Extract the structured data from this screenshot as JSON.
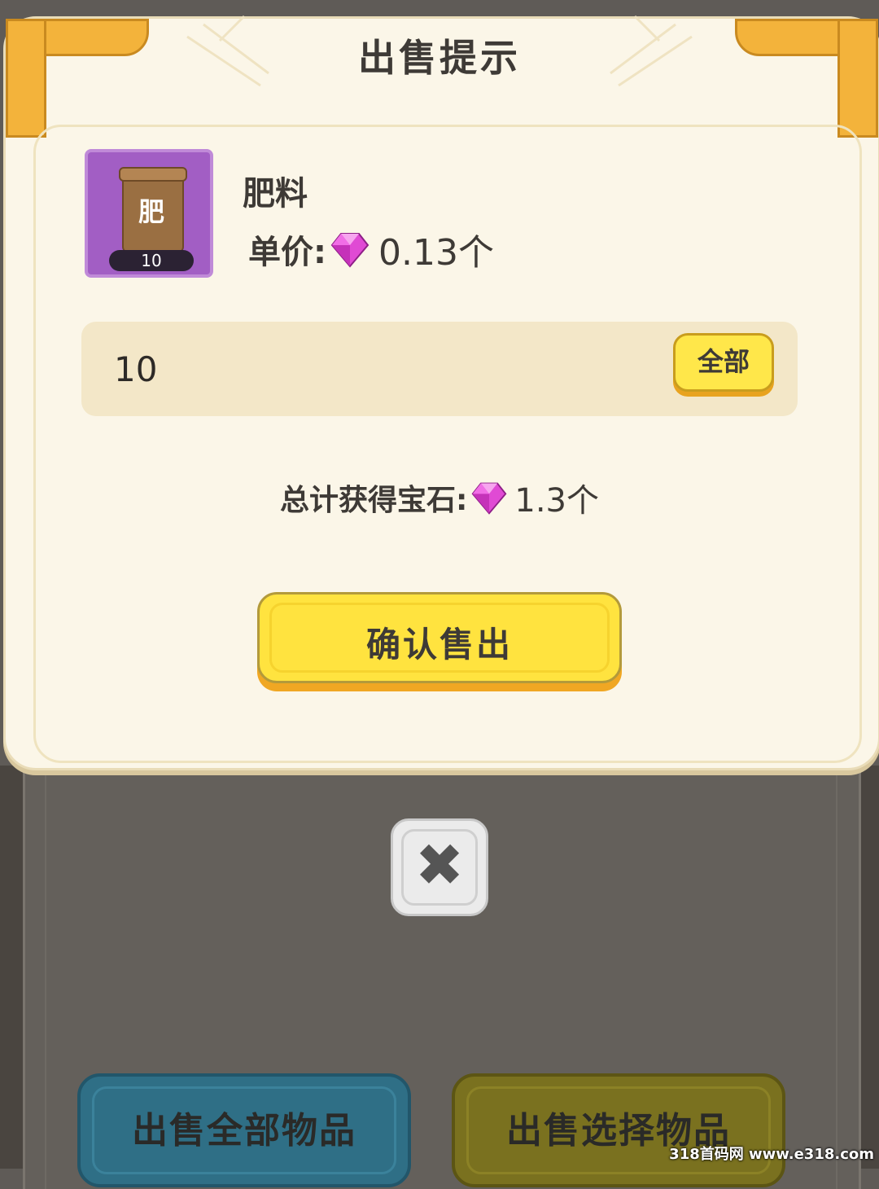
{
  "dialog": {
    "title": "出售提示",
    "item_name": "肥料",
    "item_icon_label": "肥",
    "item_count": "10",
    "unit_price_label": "单价:",
    "unit_price_value": "0.13个",
    "quantity_value": "10",
    "all_button": "全部",
    "total_label": "总计获得宝石:",
    "total_value": "1.3个",
    "confirm_button": "确认售出"
  },
  "background": {
    "sell_all_button": "出售全部物品",
    "sell_selected_button": "出售选择物品"
  },
  "watermark": "318首码网 www.e318.com",
  "colors": {
    "accent_yellow": "#ffe33f",
    "gem": "#e04ad4",
    "item_bg": "#a25ec4"
  }
}
